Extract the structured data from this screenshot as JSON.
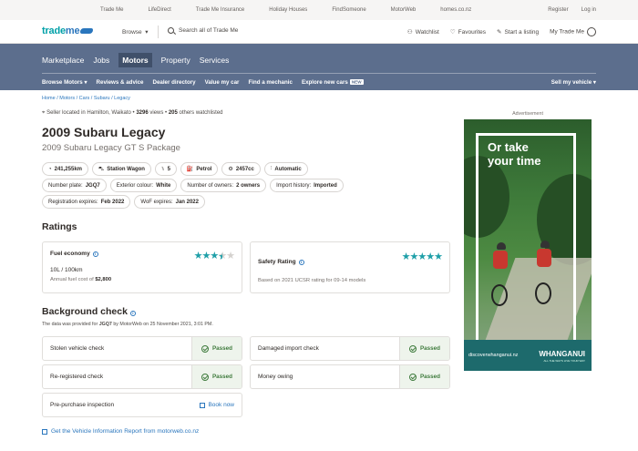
{
  "topbar": {
    "links": [
      "Trade Me",
      "LifeDirect",
      "Trade Me Insurance",
      "Holiday Houses",
      "FindSomeone",
      "MotorWeb",
      "homes.co.nz"
    ],
    "register": "Register",
    "login": "Log in"
  },
  "header": {
    "logo_trade": "trade",
    "logo_me": "me",
    "browse": "Browse",
    "search_placeholder": "Search all of Trade Me",
    "watchlist": "Watchlist",
    "favourites": "Favourites",
    "start_listing": "Start a listing",
    "my_trademe": "My Trade Me"
  },
  "nav": {
    "categories": [
      "Marketplace",
      "Jobs",
      "Motors",
      "Property",
      "Services"
    ],
    "active_category": "Motors",
    "sub": [
      "Browse Motors",
      "Reviews & advice",
      "Dealer directory",
      "Value my car",
      "Find a mechanic",
      "Explore new cars"
    ],
    "new_badge": "NEW",
    "sell": "Sell my vehicle"
  },
  "listing": {
    "breadcrumb": "Home / Motors / Cars / Subaru / Legacy",
    "location": "Seller located in Hamilton, Waikato",
    "views": "3296",
    "views_label": "views",
    "watchlisted": "205",
    "watchlisted_label": "others watchlisted",
    "title": "2009 Subaru Legacy",
    "subtitle": "2009 Subaru Legacy GT S Package",
    "specs": {
      "odometer": "241,255km",
      "body": "Station Wagon",
      "seats": "5",
      "fuel": "Petrol",
      "engine": "2457cc",
      "transmission": "Automatic"
    },
    "details": {
      "plate_label": "Number plate:",
      "plate": "JGQ7",
      "colour_label": "Exterior colour:",
      "colour": "White",
      "owners_label": "Number of owners:",
      "owners": "2 owners",
      "import_label": "Import history:",
      "import": "Imported",
      "rego_label": "Registration expires:",
      "rego": "Feb 2022",
      "wof_label": "WoF expires:",
      "wof": "Jan 2022"
    }
  },
  "ratings": {
    "heading": "Ratings",
    "fuel": {
      "title": "Fuel economy",
      "stars": 3.5,
      "max": 5,
      "value": "10L / 100km",
      "cost_label": "Annual fuel cost of",
      "cost": "$2,800"
    },
    "safety": {
      "title": "Safety Rating",
      "stars": 5,
      "max": 5,
      "note": "Based on 2021 UCSR rating for 09-14 models"
    }
  },
  "background": {
    "heading": "Background check",
    "sub_prefix": "The data was provided for",
    "sub_plate": "JGQ7",
    "sub_suffix": "by MotorWeb on 25 November 2021, 3:01 PM.",
    "checks": [
      {
        "label": "Stolen vehicle check",
        "status": "Passed"
      },
      {
        "label": "Damaged import check",
        "status": "Passed"
      },
      {
        "label": "Re-registered check",
        "status": "Passed"
      },
      {
        "label": "Money owing",
        "status": "Passed"
      }
    ],
    "inspection": "Pre-purchase inspection",
    "book": "Book now",
    "report_link": "Get the Vehicle Information Report from motorweb.co.nz"
  },
  "ad": {
    "label": "Advertisement",
    "headline1": "Or take",
    "headline2": "your time",
    "url": "discoverwhanganui.nz",
    "brand": "WHANGANUI",
    "tagline": "ALL THE WAYS LIVE YOUR WAY"
  },
  "colors": {
    "nav_bg": "#5c6e8d",
    "accent_teal": "#1e9fa8",
    "link_blue": "#2a76bd",
    "passed_green": "#3f7b3d"
  }
}
